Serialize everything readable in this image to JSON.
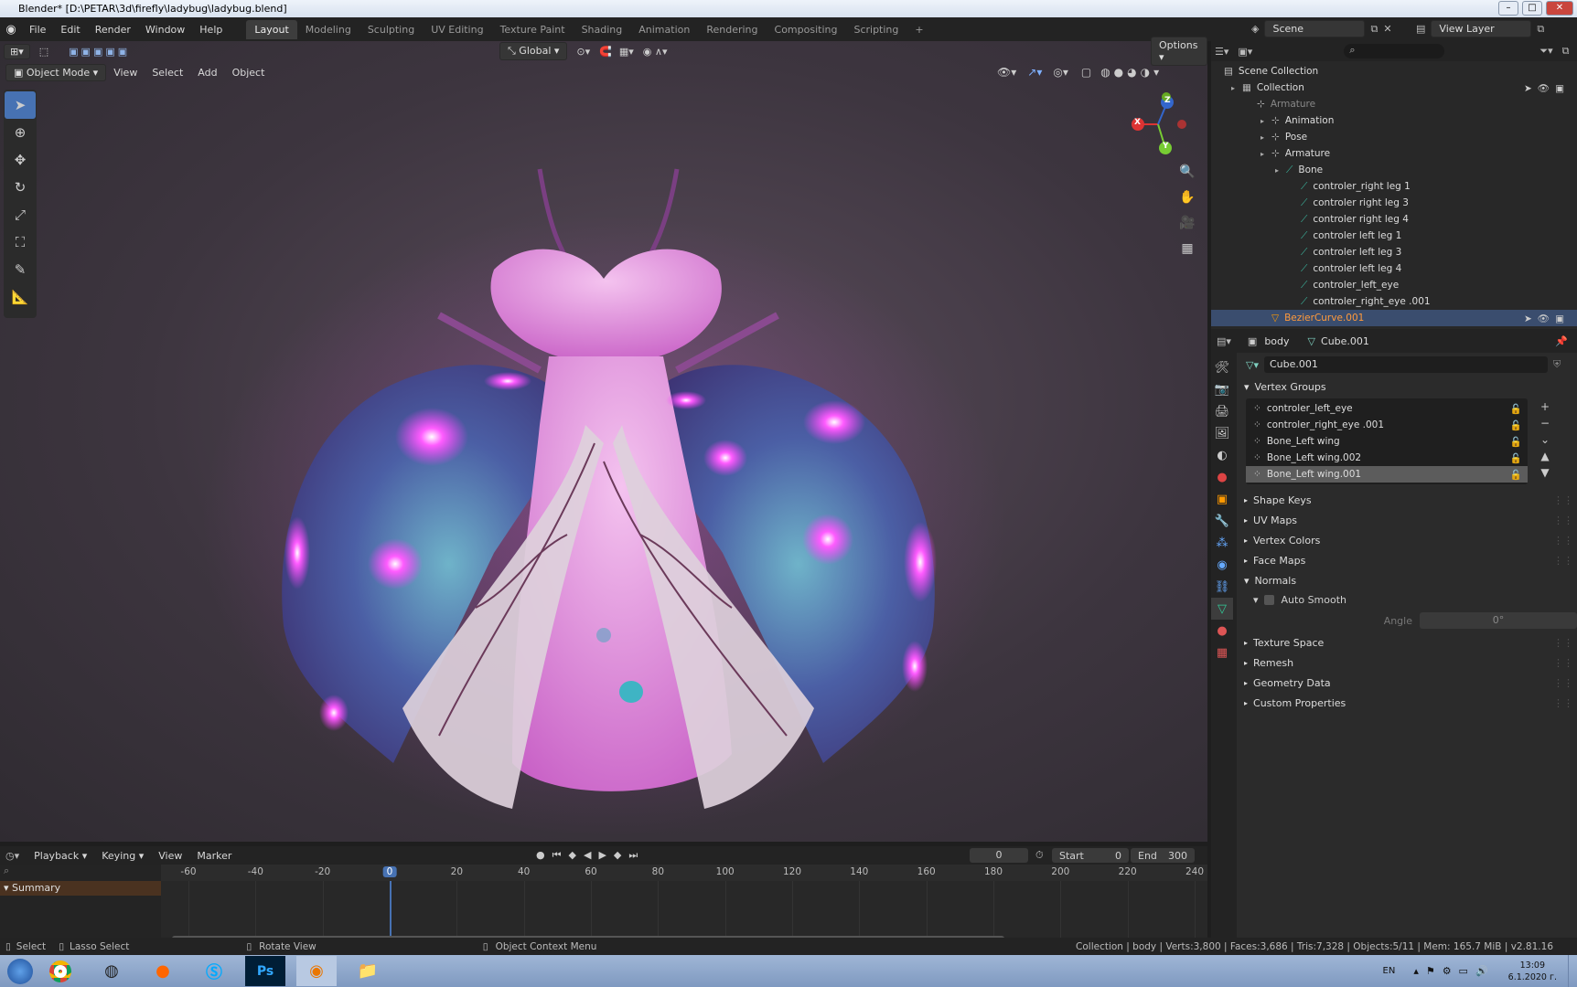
{
  "window": {
    "title": "Blender* [D:\\PETAR\\3d\\firefly\\ladybug\\ladybug.blend]"
  },
  "menubar": {
    "menus": [
      "File",
      "Edit",
      "Render",
      "Window",
      "Help"
    ],
    "workspaces": [
      "Layout",
      "Modeling",
      "Sculpting",
      "UV Editing",
      "Texture Paint",
      "Shading",
      "Animation",
      "Rendering",
      "Compositing",
      "Scripting"
    ],
    "active_workspace": "Layout",
    "scene": "Scene",
    "view_layer": "View Layer"
  },
  "viewport": {
    "mode": "Object Mode",
    "menus": [
      "View",
      "Select",
      "Add",
      "Object"
    ],
    "transform_orientation": "Global",
    "options_label": "Options",
    "gizmo": {
      "x": "X",
      "y": "Y",
      "z": "Z"
    }
  },
  "outliner": {
    "root": "Scene Collection",
    "items": [
      {
        "label": "Collection",
        "indent": 1,
        "icon": "collection-icon"
      },
      {
        "label": "Armature",
        "indent": 2,
        "icon": "armature-icon",
        "dim": true
      },
      {
        "label": "Animation",
        "indent": 3,
        "icon": "animation-icon"
      },
      {
        "label": "Pose",
        "indent": 3,
        "icon": "pose-icon"
      },
      {
        "label": "Armature",
        "indent": 3,
        "icon": "armature-data-icon"
      },
      {
        "label": "Bone",
        "indent": 4,
        "icon": "bone-icon"
      },
      {
        "label": "controler_right leg 1",
        "indent": 5,
        "icon": "bone-icon"
      },
      {
        "label": "controler right leg 3",
        "indent": 5,
        "icon": "bone-icon"
      },
      {
        "label": "controler right leg 4",
        "indent": 5,
        "icon": "bone-icon"
      },
      {
        "label": "controler left leg 1",
        "indent": 5,
        "icon": "bone-icon"
      },
      {
        "label": "controler left leg 3",
        "indent": 5,
        "icon": "bone-icon"
      },
      {
        "label": "controler left leg 4",
        "indent": 5,
        "icon": "bone-icon"
      },
      {
        "label": "controler_left_eye",
        "indent": 5,
        "icon": "bone-icon"
      },
      {
        "label": "controler_right_eye .001",
        "indent": 5,
        "icon": "bone-icon"
      },
      {
        "label": "BezierCurve.001",
        "indent": 3,
        "icon": "curve-icon",
        "selected": true
      }
    ]
  },
  "properties": {
    "object": "body",
    "mesh": "Cube.001",
    "datablock": "Cube.001",
    "vertex_groups_title": "Vertex Groups",
    "vertex_groups": [
      "controler_left_eye",
      "controler_right_eye .001",
      "Bone_Left wing",
      "Bone_Left wing.002",
      "Bone_Left wing.001"
    ],
    "selected_group": 4,
    "panels_a": [
      "Shape Keys",
      "UV Maps",
      "Vertex Colors",
      "Face Maps"
    ],
    "normals_title": "Normals",
    "auto_smooth": "Auto Smooth",
    "angle_label": "Angle",
    "angle_value": "0°",
    "panels_b": [
      "Texture Space",
      "Remesh",
      "Geometry Data",
      "Custom Properties"
    ]
  },
  "timeline": {
    "menus": [
      "Playback",
      "Keying",
      "View",
      "Marker"
    ],
    "current_frame": "0",
    "start_label": "Start",
    "start": "0",
    "end_label": "End",
    "end": "300",
    "ticks": [
      "-60",
      "-40",
      "-20",
      "0",
      "20",
      "40",
      "60",
      "80",
      "100",
      "120",
      "140",
      "160",
      "180",
      "200",
      "220",
      "240"
    ],
    "summary": "Summary"
  },
  "statusbar": {
    "select": "Select",
    "lasso": "Lasso Select",
    "rotate": "Rotate View",
    "context": "Object Context Menu",
    "stats": "Collection | body | Verts:3,800 | Faces:3,686 | Tris:7,328 | Objects:5/11 | Mem: 165.7 MiB | v2.81.16"
  },
  "taskbar": {
    "lang": "EN",
    "time": "13:09",
    "date": "6.1.2020 г."
  },
  "colors": {
    "accent": "#4772b3",
    "glow": "#ff3dff",
    "selected_text": "#ff9a3c"
  }
}
